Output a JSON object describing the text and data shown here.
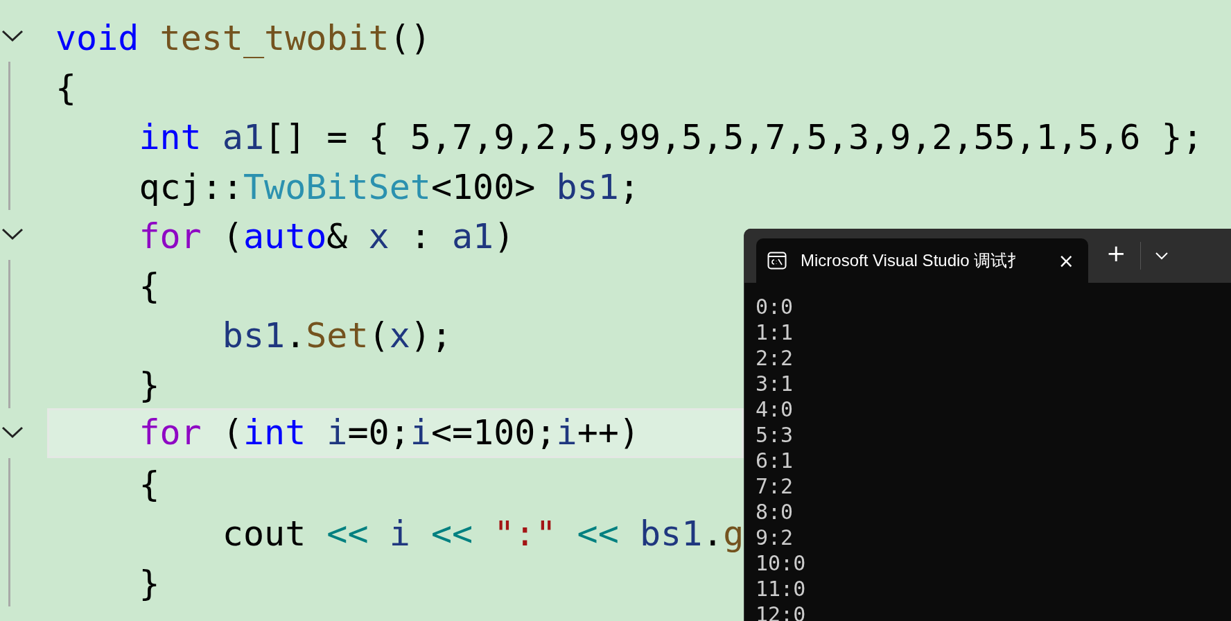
{
  "editor": {
    "lines": [
      {
        "foldable": true,
        "current": false,
        "tokens": [
          {
            "kind": "keyword",
            "text": "void"
          },
          {
            "kind": "function",
            "text": " test_twobit"
          },
          {
            "kind": "plain",
            "text": "()"
          }
        ]
      },
      {
        "foldable": false,
        "current": false,
        "tokens": [
          {
            "kind": "plain",
            "text": "{"
          }
        ]
      },
      {
        "foldable": false,
        "current": false,
        "tokens": [
          {
            "kind": "keyword",
            "text": "    int"
          },
          {
            "kind": "variable",
            "text": " a1"
          },
          {
            "kind": "plain",
            "text": "[] = { 5,7,9,2,5,99,5,5,7,5,3,9,2,55,1,5,6 };"
          }
        ]
      },
      {
        "foldable": false,
        "current": false,
        "tokens": [
          {
            "kind": "plain",
            "text": "    qcj::"
          },
          {
            "kind": "type",
            "text": "TwoBitSet"
          },
          {
            "kind": "plain",
            "text": "<100> "
          },
          {
            "kind": "variable",
            "text": "bs1"
          },
          {
            "kind": "plain",
            "text": ";"
          }
        ]
      },
      {
        "foldable": true,
        "current": false,
        "tokens": [
          {
            "kind": "control",
            "text": "    for"
          },
          {
            "kind": "plain",
            "text": " ("
          },
          {
            "kind": "keyword",
            "text": "auto"
          },
          {
            "kind": "plain",
            "text": "& "
          },
          {
            "kind": "variable",
            "text": "x"
          },
          {
            "kind": "plain",
            "text": " : "
          },
          {
            "kind": "variable",
            "text": "a1"
          },
          {
            "kind": "plain",
            "text": ")"
          }
        ]
      },
      {
        "foldable": false,
        "current": false,
        "tokens": [
          {
            "kind": "plain",
            "text": "    {"
          }
        ]
      },
      {
        "foldable": false,
        "current": false,
        "tokens": [
          {
            "kind": "variable",
            "text": "        bs1"
          },
          {
            "kind": "plain",
            "text": "."
          },
          {
            "kind": "function",
            "text": "Set"
          },
          {
            "kind": "plain",
            "text": "("
          },
          {
            "kind": "variable",
            "text": "x"
          },
          {
            "kind": "plain",
            "text": ");"
          }
        ]
      },
      {
        "foldable": false,
        "current": false,
        "tokens": [
          {
            "kind": "plain",
            "text": "    }"
          }
        ]
      },
      {
        "foldable": true,
        "current": true,
        "tokens": [
          {
            "kind": "control",
            "text": "    for"
          },
          {
            "kind": "plain",
            "text": " ("
          },
          {
            "kind": "keyword",
            "text": "int"
          },
          {
            "kind": "variable",
            "text": " i"
          },
          {
            "kind": "plain",
            "text": "=0;"
          },
          {
            "kind": "variable",
            "text": "i"
          },
          {
            "kind": "plain",
            "text": "<=100;"
          },
          {
            "kind": "variable",
            "text": "i"
          },
          {
            "kind": "plain",
            "text": "++)"
          }
        ]
      },
      {
        "foldable": false,
        "current": false,
        "tokens": [
          {
            "kind": "plain",
            "text": "    {"
          }
        ]
      },
      {
        "foldable": false,
        "current": false,
        "tokens": [
          {
            "kind": "plain",
            "text": "        cout "
          },
          {
            "kind": "operator",
            "text": "<<"
          },
          {
            "kind": "variable",
            "text": " i"
          },
          {
            "kind": "operator",
            "text": " <<"
          },
          {
            "kind": "string",
            "text": " \":\""
          },
          {
            "kind": "operator",
            "text": " <<"
          },
          {
            "kind": "variable",
            "text": " bs1"
          },
          {
            "kind": "plain",
            "text": "."
          },
          {
            "kind": "function",
            "text": "g"
          }
        ]
      },
      {
        "foldable": false,
        "current": false,
        "tokens": [
          {
            "kind": "plain",
            "text": "    }"
          }
        ]
      }
    ]
  },
  "terminal": {
    "tab": {
      "title": "Microsoft Visual Studio 调试扌",
      "close": "×"
    },
    "new_tab": "+",
    "output": [
      "0:0",
      "1:1",
      "2:2",
      "3:1",
      "4:0",
      "5:3",
      "6:1",
      "7:2",
      "8:0",
      "9:2",
      "10:0",
      "11:0",
      "12:0"
    ]
  }
}
